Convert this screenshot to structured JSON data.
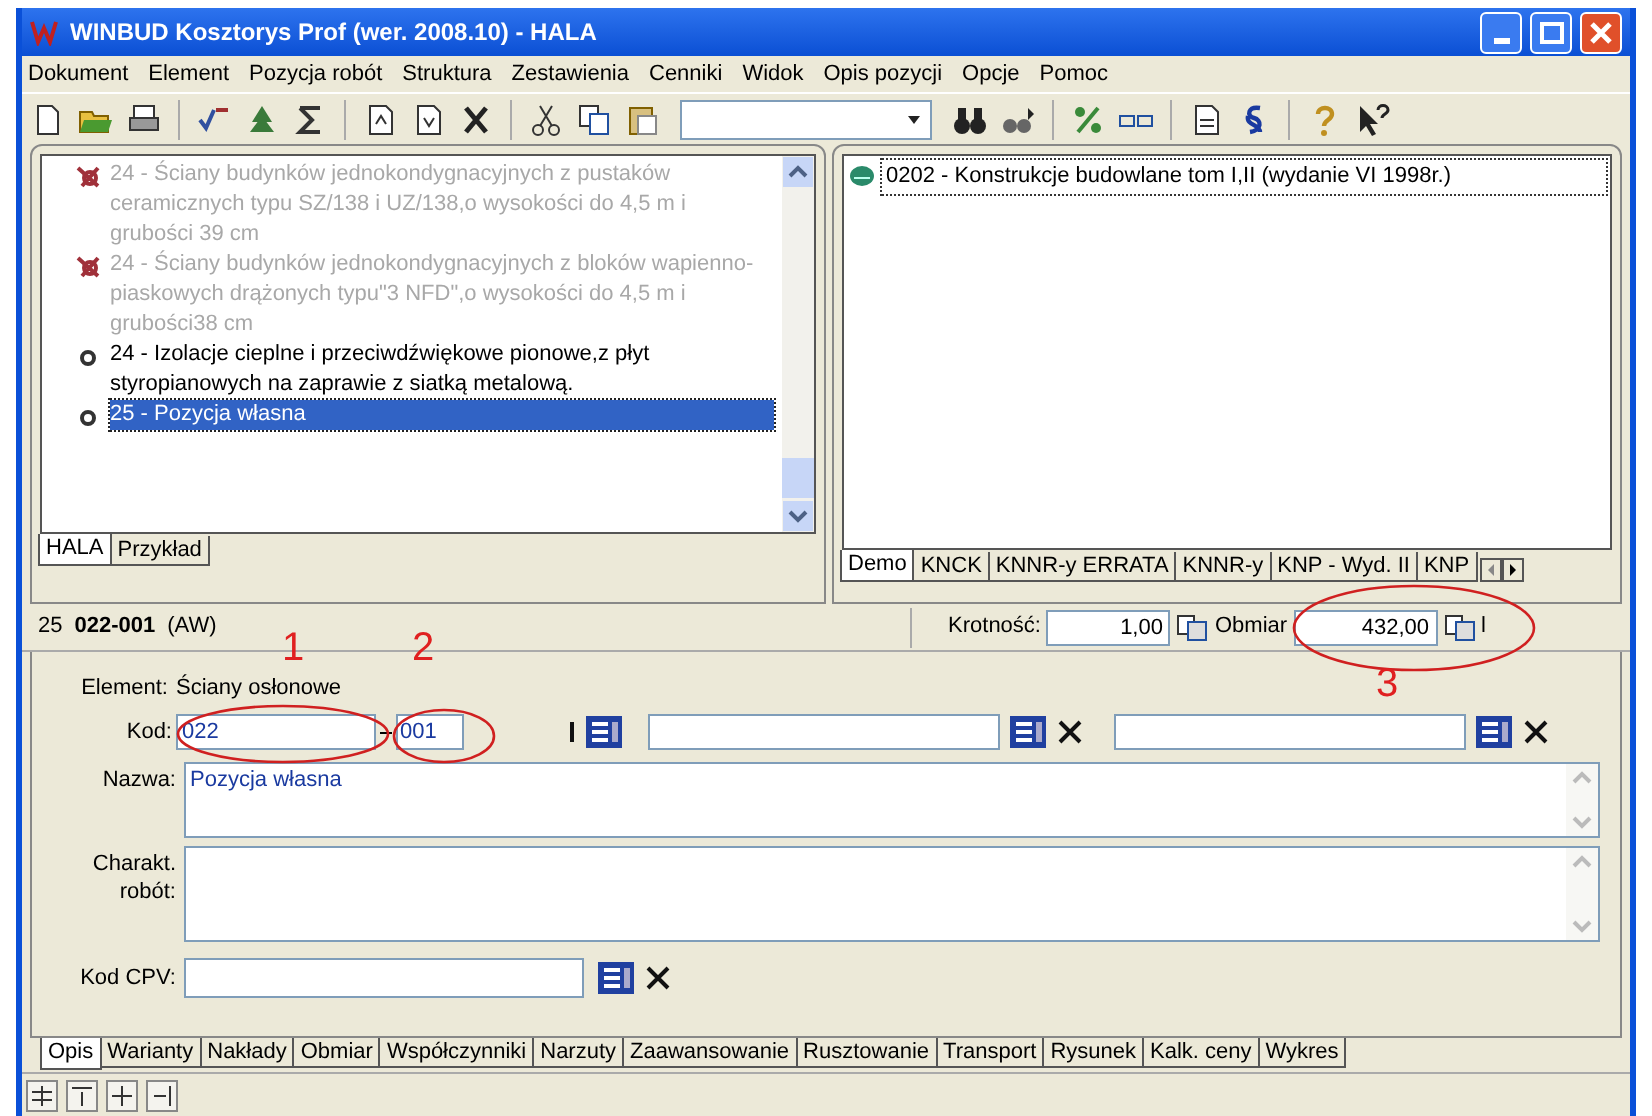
{
  "window": {
    "title": "WINBUD Kosztorys Prof (wer. 2008.10) - HALA"
  },
  "menu": [
    "Dokument",
    "Element",
    "Pozycja robót",
    "Struktura",
    "Zestawienia",
    "Cenniki",
    "Widok",
    "Opis pozycji",
    "Opcje",
    "Pomoc"
  ],
  "left_panel": {
    "items": [
      {
        "kind": "excluded",
        "text": "24 - Ściany budynków jednokondygnacyjnych z pustaków ceramicznych typu SZ/138 i UZ/138,o wysokości do 4,5 m i grubości 39 cm",
        "selected": false
      },
      {
        "kind": "excluded",
        "text": "24 - Ściany budynków jednokondygnacyjnych z bloków wapienno-piaskowych drążonych typu\"3 NFD\",o wysokości do 4,5 m i grubości38 cm",
        "selected": false
      },
      {
        "kind": "normal",
        "text": "24 - Izolacje cieplne i przeciwdźwiękowe pionowe,z płyt styropianowych na zaprawie z siatką metalową.",
        "selected": false
      },
      {
        "kind": "normal",
        "text": "25 - Pozycja własna",
        "selected": true
      }
    ],
    "tabs": [
      {
        "label": "HALA",
        "selected": true
      },
      {
        "label": "Przykład",
        "selected": false
      }
    ]
  },
  "right_panel": {
    "items": [
      {
        "text": "0202 - Konstrukcje budowlane tom I,II (wydanie VI 1998r.)",
        "selected": true
      }
    ],
    "tabs": [
      {
        "label": "Demo",
        "selected": true
      },
      {
        "label": "KNCK",
        "selected": false
      },
      {
        "label": "KNNR-y ERRATA",
        "selected": false
      },
      {
        "label": "KNNR-y",
        "selected": false
      },
      {
        "label": "KNP - Wyd. II",
        "selected": false
      },
      {
        "label": "KNP",
        "selected": false
      }
    ]
  },
  "position": {
    "number": "25",
    "code": "022-001",
    "tag": "(AW)",
    "krotnosc_label": "Krotność:",
    "krotnosc": "1,00",
    "obmiar_label": "Obmiar",
    "obmiar": "432,00",
    "unit": "l"
  },
  "form": {
    "element_label": "Element:",
    "element": "Ściany osłonowe",
    "kod_label": "Kod:",
    "kod_1": "022",
    "kod_2": "001",
    "nazwa_label": "Nazwa:",
    "nazwa": "Pozycja własna",
    "charakt_label": "Charakt. robót:",
    "cpv_label": "Kod CPV:"
  },
  "bottom_tabs": [
    {
      "label": "Opis",
      "selected": true
    },
    {
      "label": "Warianty",
      "selected": false
    },
    {
      "label": "Nakłady",
      "selected": false
    },
    {
      "label": "Obmiar",
      "selected": false
    },
    {
      "label": "Współczynniki",
      "selected": false
    },
    {
      "label": "Narzuty",
      "selected": false
    },
    {
      "label": "Zaawansowanie",
      "selected": false
    },
    {
      "label": "Rusztowanie",
      "selected": false
    },
    {
      "label": "Transport",
      "selected": false
    },
    {
      "label": "Rysunek",
      "selected": false
    },
    {
      "label": "Kalk. ceny",
      "selected": false
    },
    {
      "label": "Wykres",
      "selected": false
    }
  ],
  "annotations": [
    {
      "label": "1"
    },
    {
      "label": "2"
    },
    {
      "label": "3"
    }
  ]
}
